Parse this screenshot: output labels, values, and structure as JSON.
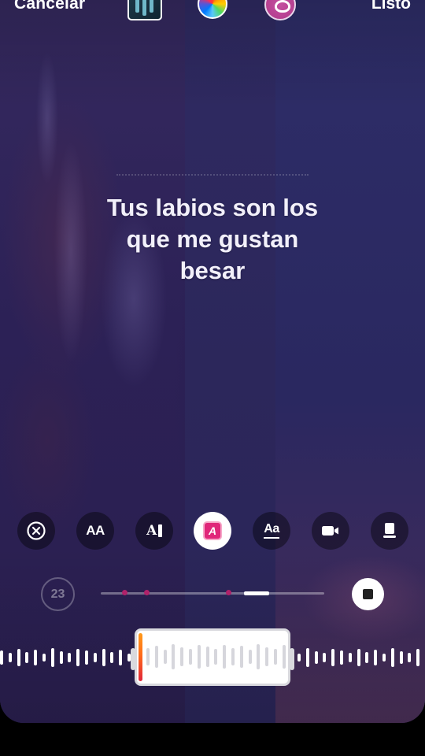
{
  "topbar": {
    "cancel_label": "Cancelar",
    "done_label": "Listo",
    "album_thumb_icon": "album-cover-thumbnail",
    "color_picker_icon": "color-wheel-icon",
    "effect_icon": "face-effect-icon"
  },
  "lyrics": {
    "line1": "Tus labios son los",
    "line2": "que me gustan",
    "line3": "besar"
  },
  "toolbar": {
    "tools": [
      {
        "name": "remove",
        "icon": "close-circle-icon",
        "label": ""
      },
      {
        "name": "text-size",
        "icon": "text-size-icon",
        "label": "AA"
      },
      {
        "name": "text-animation",
        "icon": "text-cursor-icon",
        "label": "A"
      },
      {
        "name": "text-color",
        "icon": "highlight-text-icon",
        "label": "A",
        "active": true
      },
      {
        "name": "underline-style",
        "icon": "underline-text-icon",
        "label": "Aa"
      },
      {
        "name": "video-effect",
        "icon": "video-camera-icon",
        "label": ""
      },
      {
        "name": "layout",
        "icon": "card-layout-icon",
        "label": ""
      }
    ]
  },
  "timeline": {
    "duration_counter": "23",
    "progress": 0.75,
    "stop_icon": "stop-square-icon"
  },
  "colors": {
    "accent": "#e0267a",
    "marker": "#b0226a",
    "playhead_top": "#ff9a1a",
    "playhead_bottom": "#e0263a"
  }
}
